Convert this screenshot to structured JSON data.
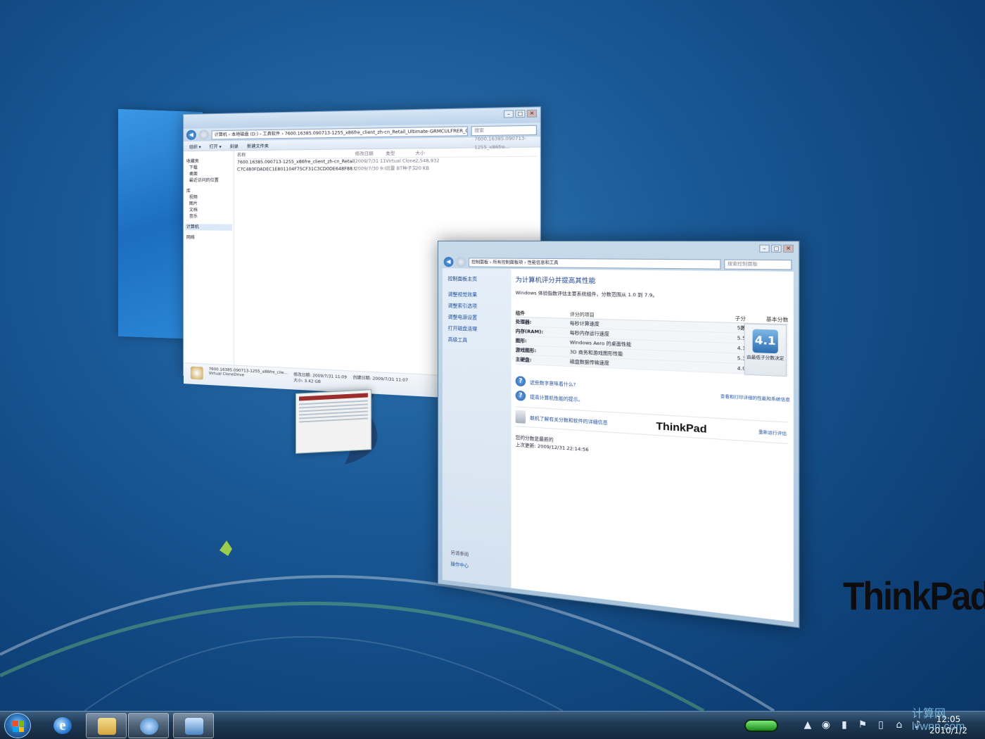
{
  "explorer": {
    "address": "计算机 › 本地磁盘 (D:) › 工具软件 › 7600.16385.090713-1255_x86fre_client_zh-cn_Retail_Ultimate-GRMCULFRER_CN_DVD.iso",
    "search_placeholder": "搜索 7600.16385.090713-1255_x86fre...",
    "toolbar": [
      "组织 ▾",
      "打开 ▾",
      "刻录",
      "新建文件夹"
    ],
    "nav": {
      "favorites": "收藏夹",
      "fav_items": [
        "下载",
        "桌面",
        "最近访问的位置"
      ],
      "library": "库",
      "lib_items": [
        "视频",
        "图片",
        "文档",
        "音乐"
      ],
      "computer": "计算机",
      "network": "网络"
    },
    "columns": [
      "名称",
      "修改日期",
      "类型",
      "大小"
    ],
    "files": [
      {
        "name": "7600.16385.090713-1255_x86fre_client_zh-cn_Retail_Ultimate-GRMCULF...",
        "date": "2009/7/31 11:09",
        "type": "Virtual CloneDrive",
        "size": "2,548,932..."
      },
      {
        "name": "C7C480FDADEC1E801104F75CF31C3CD0DE648F88.torrent",
        "date": "2009/7/30 9:09",
        "type": "迅雷 BT种子文件",
        "size": "20 KB"
      }
    ],
    "status": {
      "filename": "7600.16385.090713-1255_x86fre_clie...",
      "modified": "修改日期: 2009/7/31 11:09",
      "created": "创建日期: 2009/7/31 11:07",
      "type": "Virtual CloneDrive",
      "size": "大小: 3.42 GB"
    }
  },
  "perf": {
    "breadcrumb": [
      "控制面板",
      "所有控制面板项",
      "性能信息和工具"
    ],
    "search_placeholder": "搜索控制面板",
    "sidebar": {
      "home": "控制面板主页",
      "links": [
        "调整视觉效果",
        "调整索引选项",
        "调整电源设置",
        "打开磁盘清理",
        "高级工具"
      ],
      "see_also": "另请参阅",
      "action_center": "操作中心"
    },
    "title": "为计算机评分并提高其性能",
    "description": "Windows 体验指数评估主要系统组件，分数范围从 1.0 到 7.9。",
    "headers": {
      "component": "组件",
      "rated": "评分的项目",
      "subscore": "子分数",
      "base": "基本分数"
    },
    "rows": [
      {
        "component": "处理器:",
        "item": "每秒计算速度",
        "score": "5.9"
      },
      {
        "component": "内存(RAM):",
        "item": "每秒内存运行速度",
        "score": "5.5"
      },
      {
        "component": "图形:",
        "item": "Windows Aero 的桌面性能",
        "score": "4.1"
      },
      {
        "component": "游戏图形:",
        "item": "3D 商务和游戏图形性能",
        "score": "5.3"
      },
      {
        "component": "主硬盘:",
        "item": "磁盘数据传输速度",
        "score": "4.9"
      }
    ],
    "base_score": "4.1",
    "base_caption": "由最低子分数决定",
    "print_link": "查看和打印详细的性能和系统信息",
    "help_links": [
      "这些数字意味着什么?",
      "提高计算机性能的提示。"
    ],
    "learn_link": "联机了解有关分数和软件的详细信息",
    "logo": "ThinkPad",
    "rerun": "重新运行评估",
    "status": "您的分数是最新的",
    "last_update": "上次更新: 2009/12/31 22:14:56"
  },
  "desktop": {
    "logo": "ThinkPad"
  },
  "taskbar": {
    "time": "12:05",
    "date": "2010/1/2",
    "watermark": "计算网 lvwnn.com"
  }
}
